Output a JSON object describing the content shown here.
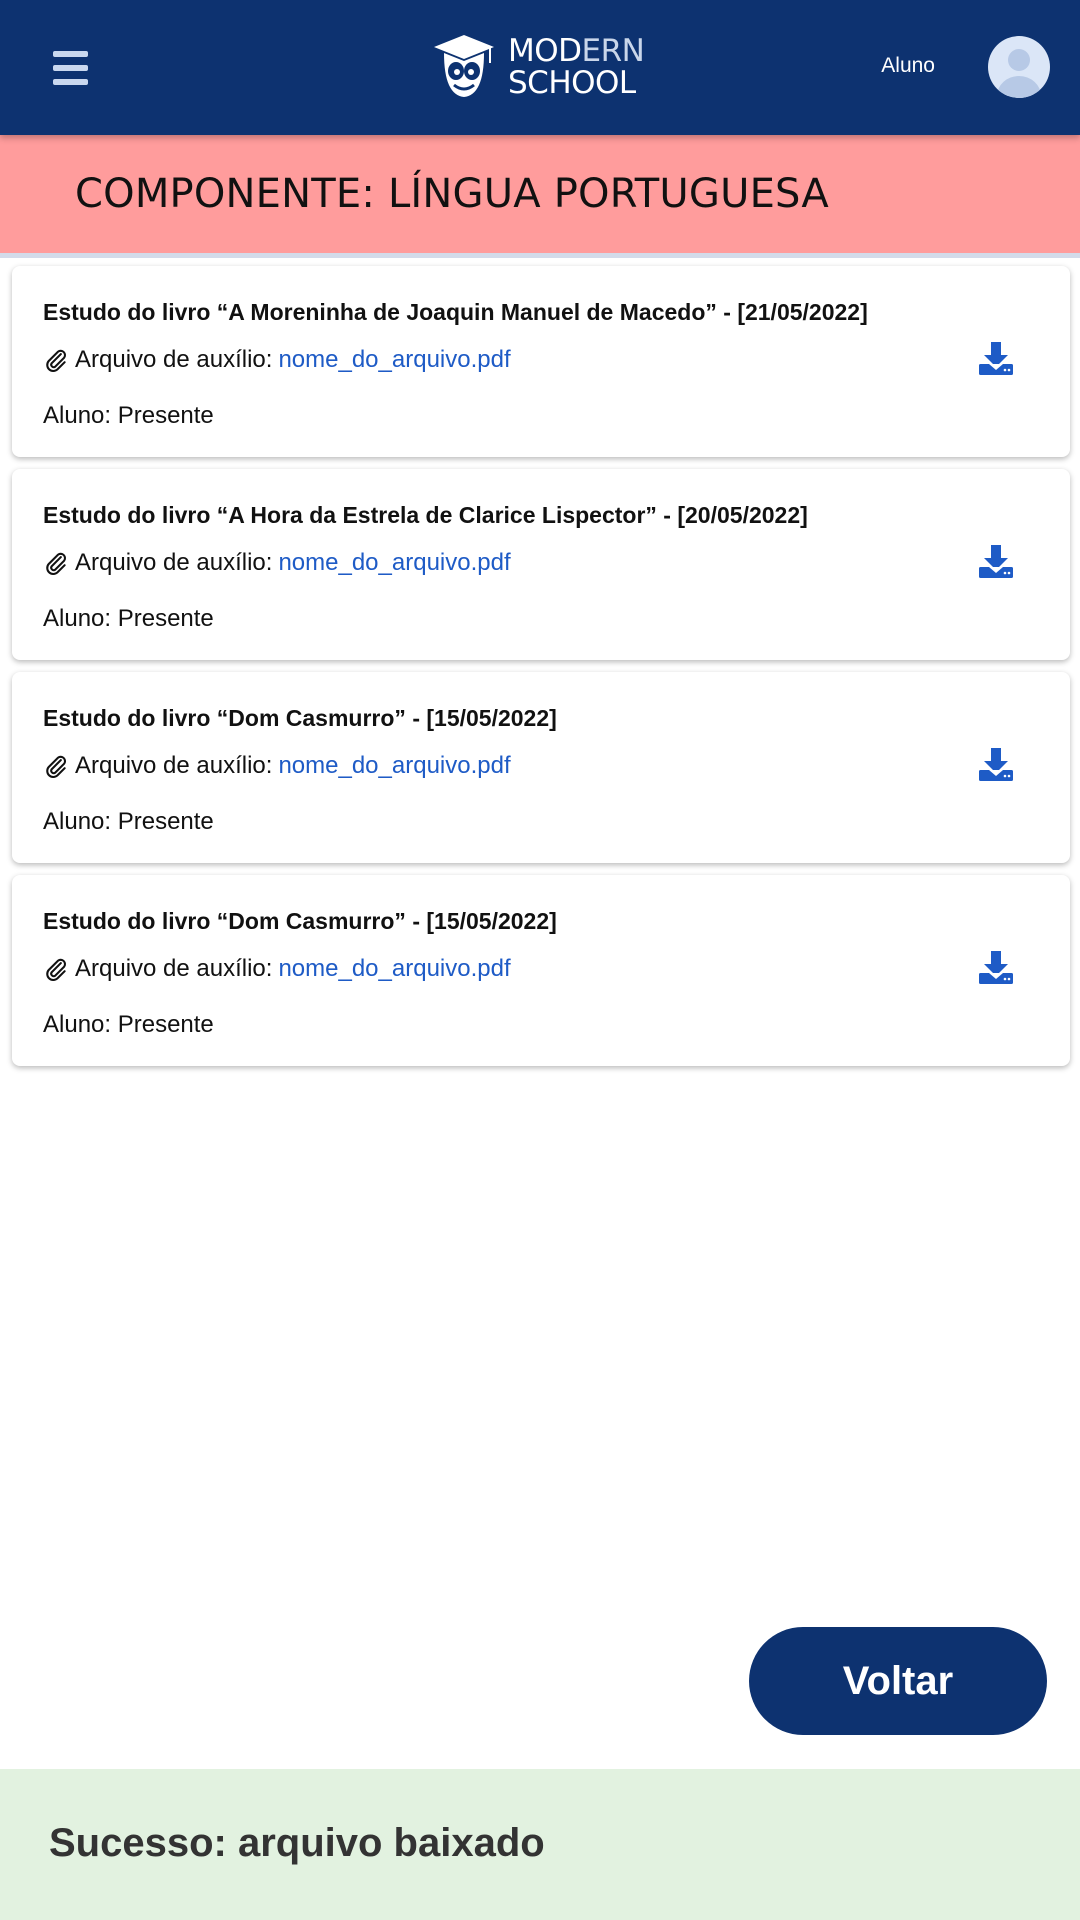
{
  "header": {
    "menu_icon": "hamburger-menu-icon",
    "logo": {
      "line1_bold": "MOD",
      "line1_rest": "ERN",
      "line2": "SCHOOL",
      "icon": "graduation-owl-icon"
    },
    "user_label": "Aluno",
    "avatar_icon": "user-avatar-icon",
    "colors": {
      "background": "#0d3270"
    }
  },
  "banner": {
    "title": "COMPONENTE: LÍNGUA PORTUGUESA",
    "color": "#ff9c9c"
  },
  "cards": [
    {
      "title": "Estudo do livro “A Moreninha  de  Joaquin Manuel de Macedo” - [21/05/2022]",
      "attachment_label": "Arquivo de auxílio:",
      "file_name": "nome_do_arquivo.pdf",
      "status": "Aluno: Presente"
    },
    {
      "title": "Estudo do livro “A Hora da Estrela de Clarice Lispector” - [20/05/2022]",
      "attachment_label": "Arquivo de auxílio:",
      "file_name": "nome_do_arquivo.pdf",
      "status": "Aluno: Presente"
    },
    {
      "title": "Estudo do livro “Dom Casmurro” - [15/05/2022]",
      "attachment_label": "Arquivo de auxílio:",
      "file_name": "nome_do_arquivo.pdf",
      "status": "Aluno: Presente"
    },
    {
      "title": "Estudo do livro “Dom Casmurro” - [15/05/2022]",
      "attachment_label": "Arquivo de auxílio:",
      "file_name": "nome_do_arquivo.pdf",
      "status": "Aluno: Presente"
    }
  ],
  "icons": {
    "attachment": "paperclip-icon",
    "download": "download-icon"
  },
  "actions": {
    "back_label": "Voltar"
  },
  "toast": {
    "message": "Sucesso: arquivo baixado",
    "color": "#e2f2e0"
  }
}
